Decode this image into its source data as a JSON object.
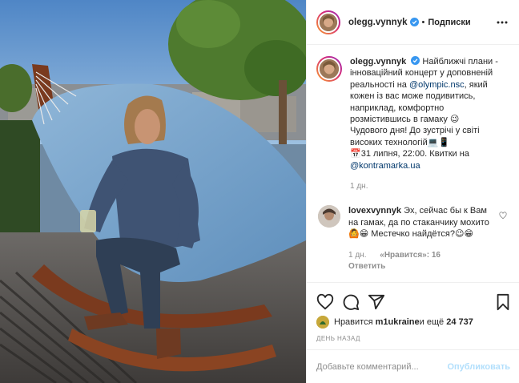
{
  "colors": {
    "link": "#00376b",
    "muted": "#8e8e8e",
    "text": "#262626",
    "publish_disabled": "#b2dffc",
    "verified": "#3897f0"
  },
  "photo": {
    "description_icon": "photo"
  },
  "header": {
    "username": "olegg.vynnyk",
    "separator": "•",
    "follow_label": "Подписки",
    "more_icon": "more-horizontal-icon"
  },
  "caption": {
    "username": "olegg.vynnyk",
    "text_1": "Найближчі плани - інноваційний концерт у доповненій реальності на ",
    "mention_1": "@olympic.nsc",
    "text_2": ", який кожен із вас може подивитись, наприклад, комфортно розмістившись в гамаку 😉 Чудового дня! До зустрічі у світі високих технологій💻📱",
    "text_3": "📅31 липня, 22:00. Квитки на ",
    "mention_2": "@kontramarka.ua",
    "time": "1 дн."
  },
  "comment": {
    "username": "lovexvynnyk",
    "text": "Эх, сейчас бы к Вам на гамак, да по стаканчику мохито🙆😁 Местечко найдётся?😉😁",
    "time": "1 дн.",
    "likes": "«Нравится»: 16",
    "reply_label": "Ответить"
  },
  "actions": {
    "like_icon": "heart-icon",
    "comment_icon": "comment-icon",
    "share_icon": "share-icon",
    "save_icon": "bookmark-icon"
  },
  "likes": {
    "prefix": "Нравится ",
    "liker": "m1ukraine",
    "middle": " и ещё ",
    "count": "24 737"
  },
  "date": "ДЕНЬ НАЗАД",
  "add_comment": {
    "placeholder": "Добавьте комментарий...",
    "publish_label": "Опубликовать"
  }
}
